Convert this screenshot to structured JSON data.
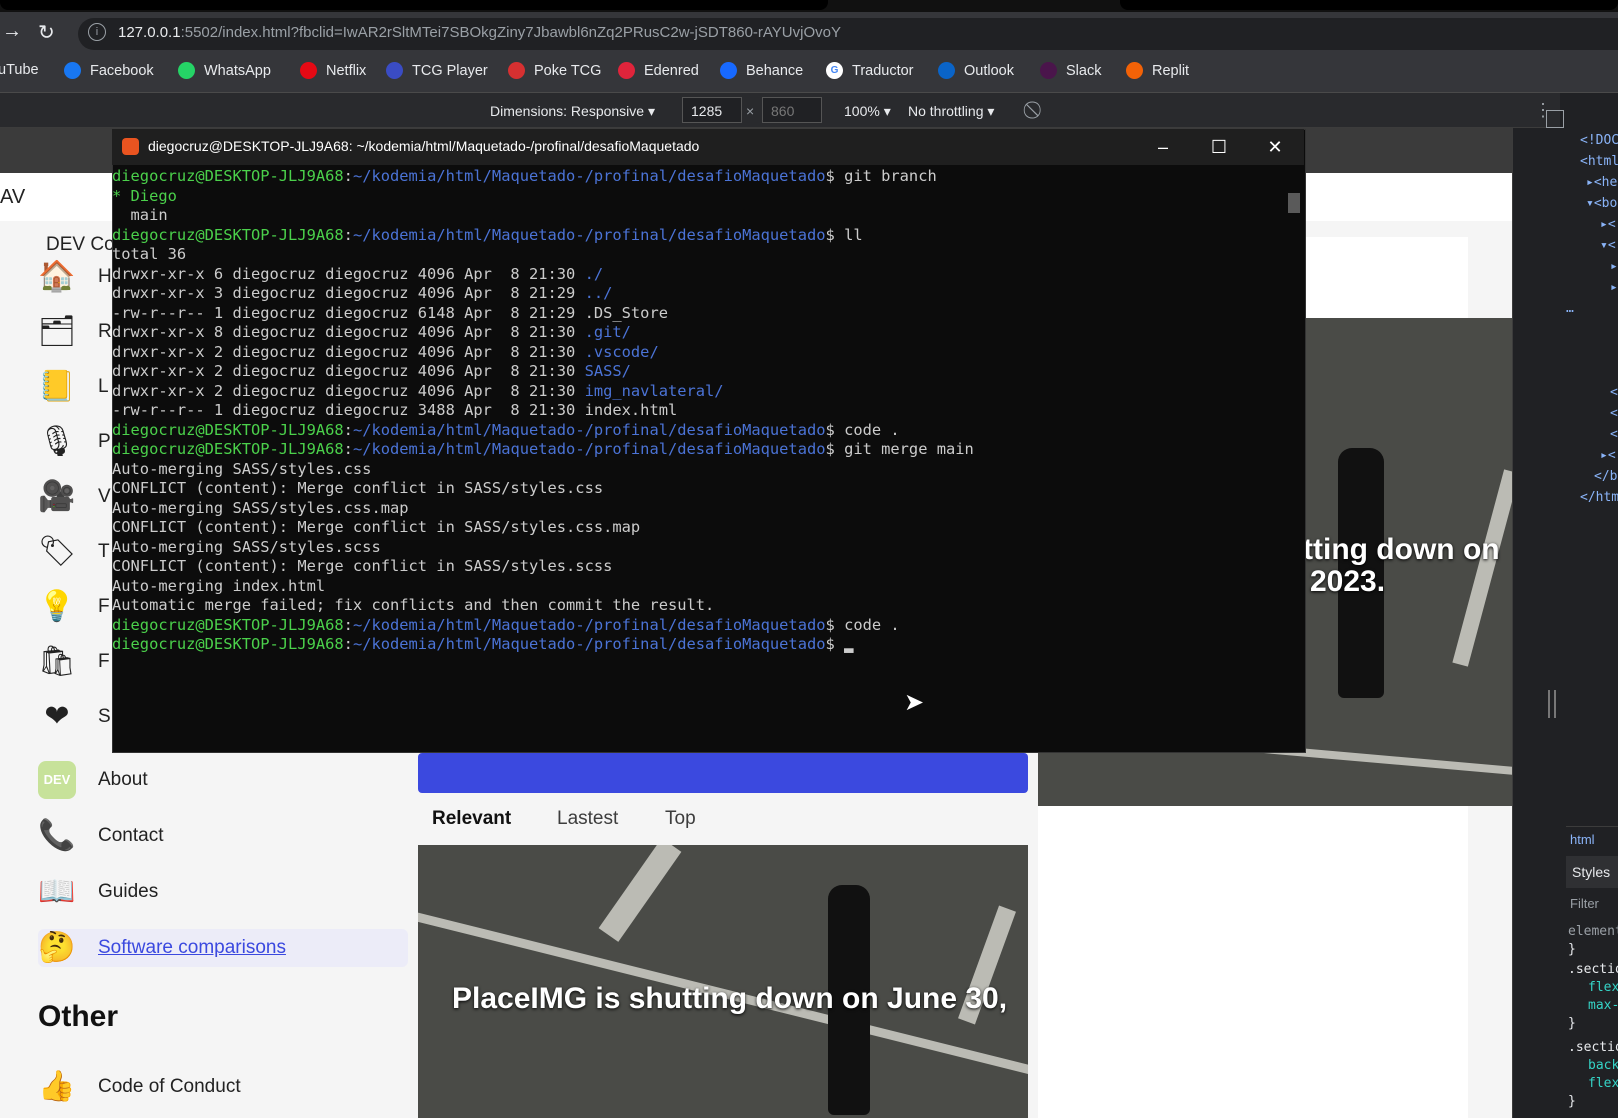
{
  "browser": {
    "url_host": "127.0.0.1",
    "url_rest": ":5502/index.html?fbclid=IwAR2rSltMTei7SBOkgZiny7Jbawbl6nZq2PRusC2w-jSDT860-rAYUvjOvoY",
    "bookmarks": [
      {
        "label": "uTube",
        "icon": "youtube-icon",
        "color": "#ff0000"
      },
      {
        "label": "Facebook",
        "icon": "facebook-icon",
        "color": "#1877f2"
      },
      {
        "label": "WhatsApp",
        "icon": "whatsapp-icon",
        "color": "#25d366"
      },
      {
        "label": "Netflix",
        "icon": "netflix-icon",
        "color": "#e50914"
      },
      {
        "label": "TCG Player",
        "icon": "tcgplayer-icon",
        "color": "#3a4cc4"
      },
      {
        "label": "Poke TCG",
        "icon": "pokeball-icon",
        "color": "#d63031"
      },
      {
        "label": "Edenred",
        "icon": "edenred-icon",
        "color": "#e0243b"
      },
      {
        "label": "Behance",
        "icon": "behance-icon",
        "color": "#1769ff"
      },
      {
        "label": "Traductor",
        "icon": "google-icon",
        "color": "#ffffff"
      },
      {
        "label": "Outlook",
        "icon": "outlook-icon",
        "color": "#0a64c8"
      },
      {
        "label": "Slack",
        "icon": "slack-icon",
        "color": "#4a154b"
      },
      {
        "label": "Replit",
        "icon": "replit-icon",
        "color": "#f26207"
      }
    ]
  },
  "devtools_bar": {
    "dimensions": "Dimensions: Responsive ▾",
    "width": "1285",
    "times": "×",
    "height": "860",
    "zoom": "100% ▾",
    "throttle": "No throttling ▾"
  },
  "page": {
    "header_partial": "AV",
    "brand_partial": "DEV Co",
    "sidebar_partial": [
      {
        "letter": "H",
        "icon": "house-icon",
        "glyph": "🏠"
      },
      {
        "letter": "R",
        "icon": "reading-list-icon",
        "glyph": "🗂"
      },
      {
        "letter": "L",
        "icon": "notes-icon",
        "glyph": "📒"
      },
      {
        "letter": "P",
        "icon": "microphone-icon",
        "glyph": "🎙"
      },
      {
        "letter": "V",
        "icon": "video-camera-icon",
        "glyph": "🎥"
      },
      {
        "letter": "T",
        "icon": "tag-icon",
        "glyph": "🏷"
      },
      {
        "letter": "F",
        "icon": "lightbulb-icon",
        "glyph": "💡"
      },
      {
        "letter": "F",
        "icon": "shopping-bag-icon",
        "glyph": "🛍"
      },
      {
        "letter": "S",
        "icon": "heart-icon",
        "glyph": "❤"
      }
    ],
    "sidebar_full": [
      {
        "label": "About",
        "icon": "dev-logo-icon",
        "glyph": "DEV"
      },
      {
        "label": "Contact",
        "icon": "contact-icon",
        "glyph": "📞"
      },
      {
        "label": "Guides",
        "icon": "book-icon",
        "glyph": "📖"
      },
      {
        "label": "Software comparisons",
        "icon": "thinking-face-icon",
        "glyph": "🤔"
      }
    ],
    "other_heading": "Other",
    "other_items": [
      {
        "label": "Code of Conduct",
        "icon": "thumbs-up-icon",
        "glyph": "👍"
      }
    ],
    "feed_tabs": [
      "Relevant",
      "Lastest",
      "Top"
    ],
    "hero_main_text": "PlaceIMG is shutting down on June 30,",
    "hero_side_line1": "tting down on",
    "hero_side_line2": "2023.",
    "link_color": "#3b49df"
  },
  "devtools_panel": {
    "dom_lines": [
      "<!DOC",
      "<html",
      "▸<he",
      "▾<bo",
      "▸<",
      "▾<",
      "▸",
      "▸",
      "…",
      "</",
      "<",
      "<",
      "▸<",
      "</b",
      "</htm"
    ],
    "tab_html": "html",
    "styles_tab": "Styles",
    "filter": "Filter",
    "css_lines": [
      "element",
      "}",
      ".sectio",
      "flex",
      "max-",
      "}",
      ".sectio",
      "back",
      "flex",
      "}"
    ]
  },
  "terminal": {
    "title": "diegocruz@DESKTOP-JLJ9A68: ~/kodemia/html/Maquetado-/profinal/desafioMaquetado",
    "user": "diegocruz@DESKTOP-JLJ9A68",
    "path": "~/kodemia/html/Maquetado-/profinal/desafioMaquetado",
    "lines": [
      {
        "t": "prompt",
        "cmd": " git branch"
      },
      {
        "t": "green",
        "text": "* Diego"
      },
      {
        "t": "plain",
        "text": "  main"
      },
      {
        "t": "prompt",
        "cmd": " ll"
      },
      {
        "t": "plain",
        "text": "total 36"
      },
      {
        "t": "ls",
        "text": "drwxr-xr-x 6 diegocruz diegocruz 4096 Apr  8 21:30 ",
        "name": "./",
        "dir": true
      },
      {
        "t": "ls",
        "text": "drwxr-xr-x 3 diegocruz diegocruz 4096 Apr  8 21:29 ",
        "name": "../",
        "dir": true
      },
      {
        "t": "ls",
        "text": "-rw-r--r-- 1 diegocruz diegocruz 6148 Apr  8 21:29 ",
        "name": ".DS_Store",
        "dir": false
      },
      {
        "t": "ls",
        "text": "drwxr-xr-x 8 diegocruz diegocruz 4096 Apr  8 21:30 ",
        "name": ".git/",
        "dir": true
      },
      {
        "t": "ls",
        "text": "drwxr-xr-x 2 diegocruz diegocruz 4096 Apr  8 21:30 ",
        "name": ".vscode/",
        "dir": true
      },
      {
        "t": "ls",
        "text": "drwxr-xr-x 2 diegocruz diegocruz 4096 Apr  8 21:30 ",
        "name": "SASS/",
        "dir": true
      },
      {
        "t": "ls",
        "text": "drwxr-xr-x 2 diegocruz diegocruz 4096 Apr  8 21:30 ",
        "name": "img_navlateral/",
        "dir": true
      },
      {
        "t": "ls",
        "text": "-rw-r--r-- 1 diegocruz diegocruz 3488 Apr  8 21:30 ",
        "name": "index.html",
        "dir": false
      },
      {
        "t": "prompt",
        "cmd": " code ."
      },
      {
        "t": "prompt",
        "cmd": " git merge main"
      },
      {
        "t": "plain",
        "text": "Auto-merging SASS/styles.css"
      },
      {
        "t": "plain",
        "text": "CONFLICT (content): Merge conflict in SASS/styles.css"
      },
      {
        "t": "plain",
        "text": "Auto-merging SASS/styles.css.map"
      },
      {
        "t": "plain",
        "text": "CONFLICT (content): Merge conflict in SASS/styles.css.map"
      },
      {
        "t": "plain",
        "text": "Auto-merging SASS/styles.scss"
      },
      {
        "t": "plain",
        "text": "CONFLICT (content): Merge conflict in SASS/styles.scss"
      },
      {
        "t": "plain",
        "text": "Auto-merging index.html"
      },
      {
        "t": "plain",
        "text": "Automatic merge failed; fix conflicts and then commit the result."
      },
      {
        "t": "prompt",
        "cmd": " code ."
      },
      {
        "t": "prompt",
        "cmd": " ▂"
      }
    ]
  }
}
